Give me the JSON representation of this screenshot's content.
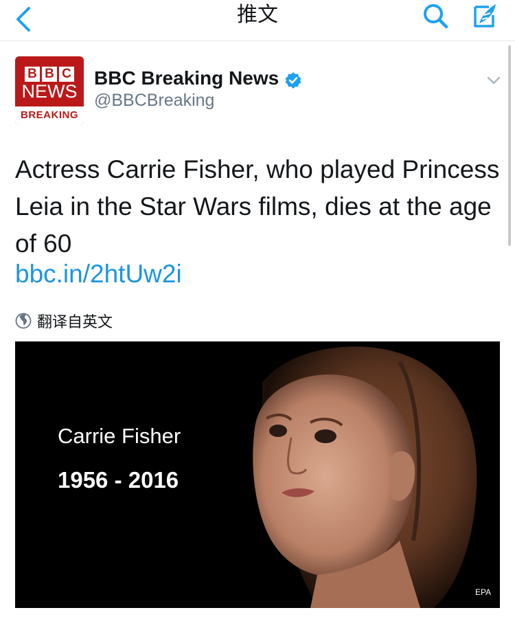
{
  "nav": {
    "title": "推文",
    "back_icon": "chevron-left-icon",
    "search_icon": "search-icon",
    "compose_icon": "compose-icon",
    "accent_color": "#1da1f2"
  },
  "tweet": {
    "avatar": {
      "bbc_letters": [
        "B",
        "B",
        "C"
      ],
      "news": "NEWS",
      "breaking": "BREAKING",
      "brand_color": "#bb1919"
    },
    "author_name": "BBC Breaking News",
    "author_handle": "@BBCBreaking",
    "verified_icon": "verified-badge-icon",
    "text": "Actress Carrie Fisher, who played Princess Leia in the Star Wars films, dies at the age of 60",
    "link": "bbc.in/2htUw2i",
    "link_color": "#1b95e0",
    "translate_label": "翻译自英文",
    "media": {
      "caption_name": "Carrie Fisher",
      "caption_years": "1956 - 2016",
      "credit": "EPA"
    }
  }
}
